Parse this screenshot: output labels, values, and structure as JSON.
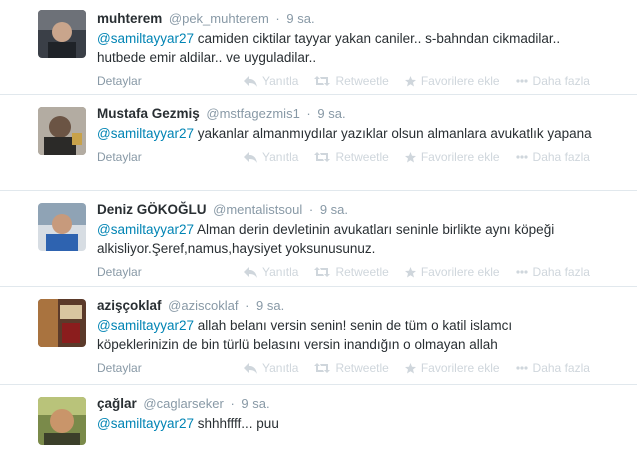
{
  "colors": {
    "mention": "#0084b4",
    "muted": "#8899a6",
    "action": "#cfd6dc",
    "border": "#e1e8ed"
  },
  "actions": {
    "details": "Detaylar",
    "reply": "Yanıtla",
    "retweet": "Retweetle",
    "favorite": "Favorilere ekle",
    "more": "Daha fazla"
  },
  "tweets": [
    {
      "fullname": "muhterem",
      "username": "@pek_muhterem",
      "time": "9 sa.",
      "mention": "@samiltayyar27",
      "text": " camiden ciktilar tayyar yakan caniler.. s-bahndan cikmadilar.. hutbede emir aldilar.. ve uyguladilar.."
    },
    {
      "fullname": "Mustafa Gezmiş",
      "username": "@mstfagezmis1",
      "time": "9 sa.",
      "mention": "@samiltayyar27",
      "text": "  yakanlar almanmıydılar yazıklar olsun almanlara avukatlık yapana"
    },
    {
      "fullname": "Deniz GÖKOĞLU",
      "username": "@mentalistsoul",
      "time": "9 sa.",
      "mention": "@samiltayyar27",
      "text": " Alman derin devletinin avukatları seninle birlikte aynı köpeği alkisliyor.Şeref,namus,haysiyet yoksunusunuz."
    },
    {
      "fullname": "azişçoklaf",
      "username": "@aziscoklaf",
      "time": "9 sa.",
      "mention": "@samiltayyar27",
      "text": " allah belanı versin senin! senin de tüm o katil islamcı köpeklerinizin de bin türlü belasını versin inandığın o olmayan allah"
    },
    {
      "fullname": "çağlar",
      "username": "@caglarseker",
      "time": "9 sa.",
      "mention": "@samiltayyar27",
      "text": " shhhffff... puu"
    }
  ]
}
